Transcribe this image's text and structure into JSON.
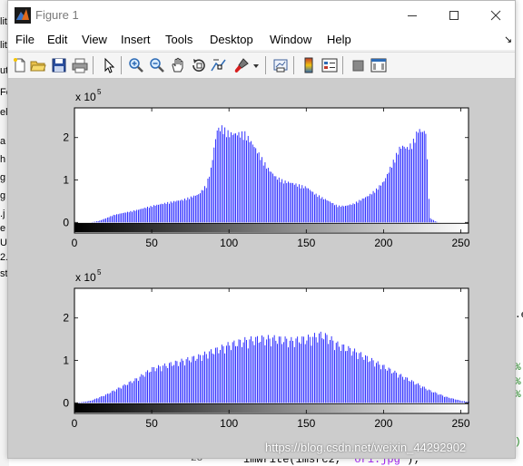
{
  "window": {
    "title": "Figure 1"
  },
  "menu": [
    "File",
    "Edit",
    "View",
    "Insert",
    "Tools",
    "Desktop",
    "Window",
    "Help"
  ],
  "toolbar_icons": [
    "new-figure-icon",
    "open-file-icon",
    "save-icon",
    "print-icon",
    "pointer-icon",
    "zoom-in-icon",
    "zoom-out-icon",
    "pan-icon",
    "rotate-3d-icon",
    "data-cursor-icon",
    "brush-icon",
    "dropdown-arrow-icon",
    "link-plot-icon",
    "colorbar-icon",
    "legend-icon",
    "hide-plot-tools-icon",
    "show-plot-tools-icon"
  ],
  "background": {
    "left_fragments": [
      "lit",
      "lit",
      "ut",
      "Fo",
      "elf",
      "a",
      "h",
      "g",
      "g",
      ".j",
      "e",
      "U",
      "2.",
      "st"
    ],
    "right_fragments": [
      ".e",
      "%",
      "%",
      "%",
      ")"
    ],
    "line_number": "28 -",
    "code_prefix": "imwrite(imsrc2, ",
    "code_string": "'ori.jpg'",
    "code_suffix": ");"
  },
  "watermark": "https://blog.csdn.net/weixin_44292902",
  "colors": {
    "bar": "#0000ff",
    "canvas_bg": "#cccccc",
    "axes_bg": "#ffffff"
  },
  "chart_data": [
    {
      "type": "bar",
      "title": "",
      "xlabel": "",
      "ylabel": "",
      "multiplier_label": "x 10",
      "multiplier_exp": "5",
      "x_ticks": [
        "0",
        "50",
        "100",
        "150",
        "200",
        "250"
      ],
      "y_ticks": [
        "0",
        "1",
        "2"
      ],
      "xlim": [
        0,
        255
      ],
      "ylim": [
        -0.25,
        2.7
      ],
      "colorbar": "grayscale",
      "x_points": [
        0,
        10,
        15,
        20,
        25,
        30,
        40,
        50,
        60,
        70,
        80,
        85,
        88,
        90,
        92,
        95,
        100,
        105,
        110,
        115,
        120,
        125,
        130,
        135,
        140,
        145,
        150,
        155,
        160,
        165,
        170,
        175,
        180,
        185,
        190,
        195,
        200,
        205,
        210,
        212,
        215,
        218,
        220,
        222,
        225,
        227,
        228,
        229,
        230,
        233,
        235,
        255
      ],
      "values": [
        0,
        0,
        0.03,
        0.1,
        0.18,
        0.22,
        0.3,
        0.4,
        0.48,
        0.55,
        0.68,
        0.9,
        1.3,
        1.8,
        2.25,
        2.3,
        2.15,
        2.15,
        2.15,
        1.9,
        1.6,
        1.3,
        1.1,
        1.0,
        0.96,
        0.9,
        0.85,
        0.7,
        0.6,
        0.5,
        0.4,
        0.4,
        0.45,
        0.55,
        0.65,
        0.8,
        1.0,
        1.4,
        1.8,
        1.85,
        1.8,
        1.9,
        2.05,
        2.25,
        2.2,
        2.2,
        1.5,
        0.6,
        0.1,
        0.03,
        0,
        0
      ]
    },
    {
      "type": "bar",
      "title": "",
      "xlabel": "",
      "ylabel": "",
      "multiplier_label": "x 10",
      "multiplier_exp": "5",
      "x_ticks": [
        "0",
        "50",
        "100",
        "150",
        "200",
        "250"
      ],
      "y_ticks": [
        "0",
        "1",
        "2"
      ],
      "xlim": [
        0,
        255
      ],
      "ylim": [
        -0.25,
        2.7
      ],
      "colorbar": "grayscale",
      "x_points": [
        0,
        5,
        10,
        20,
        30,
        40,
        50,
        60,
        70,
        80,
        90,
        100,
        110,
        120,
        130,
        140,
        150,
        155,
        160,
        165,
        170,
        180,
        190,
        200,
        210,
        220,
        230,
        240,
        250,
        255
      ],
      "values": [
        0,
        0.02,
        0.05,
        0.2,
        0.4,
        0.6,
        0.85,
        0.95,
        1.05,
        1.15,
        1.3,
        1.45,
        1.55,
        1.6,
        1.6,
        1.55,
        1.6,
        1.65,
        1.7,
        1.6,
        1.45,
        1.3,
        1.1,
        0.9,
        0.7,
        0.5,
        0.3,
        0.15,
        0.05,
        0.02
      ]
    }
  ]
}
